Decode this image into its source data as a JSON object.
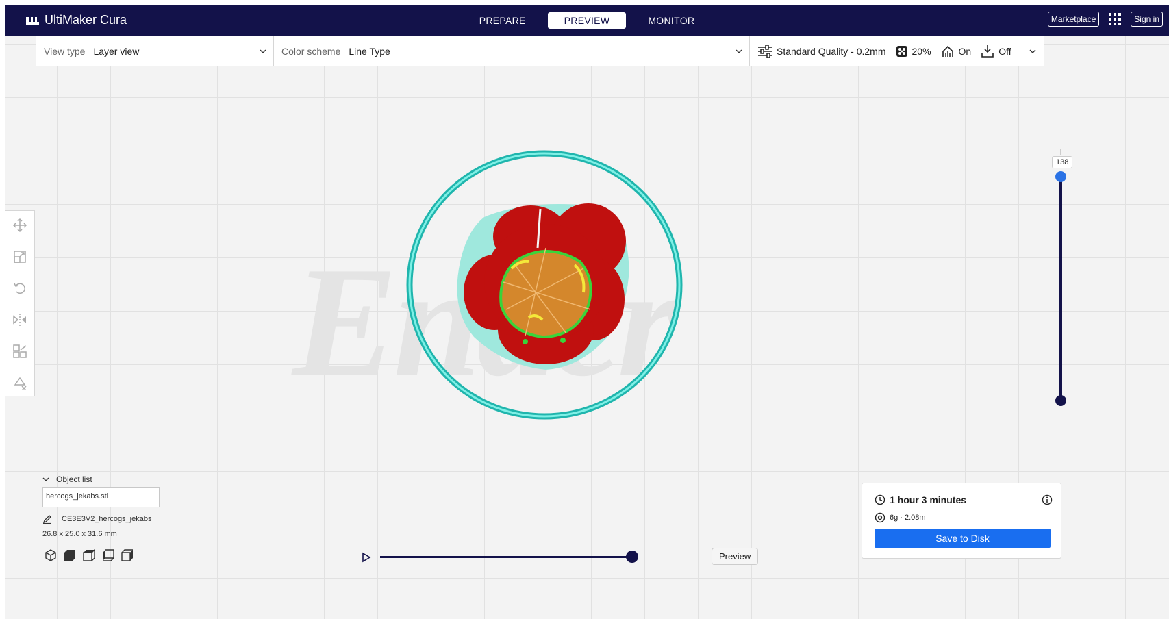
{
  "app": {
    "title": "UltiMaker Cura"
  },
  "stages": [
    {
      "label": "PREPARE",
      "active": false
    },
    {
      "label": "PREVIEW",
      "active": true
    },
    {
      "label": "MONITOR",
      "active": false
    }
  ],
  "header": {
    "marketplace": "Marketplace",
    "sign_in": "Sign in",
    "apps_icon": "apps-grid-icon"
  },
  "settings": {
    "view_type_label": "View type",
    "view_type_value": "Layer view",
    "color_scheme_label": "Color scheme",
    "color_scheme_value": "Line Type",
    "quality": "Standard Quality - 0.2mm",
    "infill": "20%",
    "support": "On",
    "adhesion": "Off"
  },
  "viewport": {
    "watermark": "Ender"
  },
  "tools": [
    "move-tool-icon",
    "scale-tool-icon",
    "rotate-tool-icon",
    "mirror-tool-icon",
    "per-model-settings-icon",
    "support-blocker-icon"
  ],
  "layer": {
    "current": "138"
  },
  "object_list": {
    "header": "Object list",
    "file_name": "hercogs_jekabs.stl",
    "job_name": "CE3E3V2_hercogs_jekabs",
    "dimensions": "26.8 x 25.0 x 31.6 mm"
  },
  "view_buttons": [
    "3d-view-icon",
    "front-view-icon",
    "top-view-icon",
    "left-view-icon",
    "right-view-icon"
  ],
  "playback": {
    "tooltip": "Preview"
  },
  "print_info": {
    "time": "1 hour 3 minutes",
    "material": "6g · 2.08m",
    "save_label": "Save to Disk"
  },
  "colors": {
    "header_bg": "#13124a",
    "accent_blue": "#196ef0",
    "model_red": "#c0100f",
    "skirt_cyan": "#35d4c8",
    "infill_orange": "#d4872c",
    "wall_green": "#3ad43a"
  }
}
